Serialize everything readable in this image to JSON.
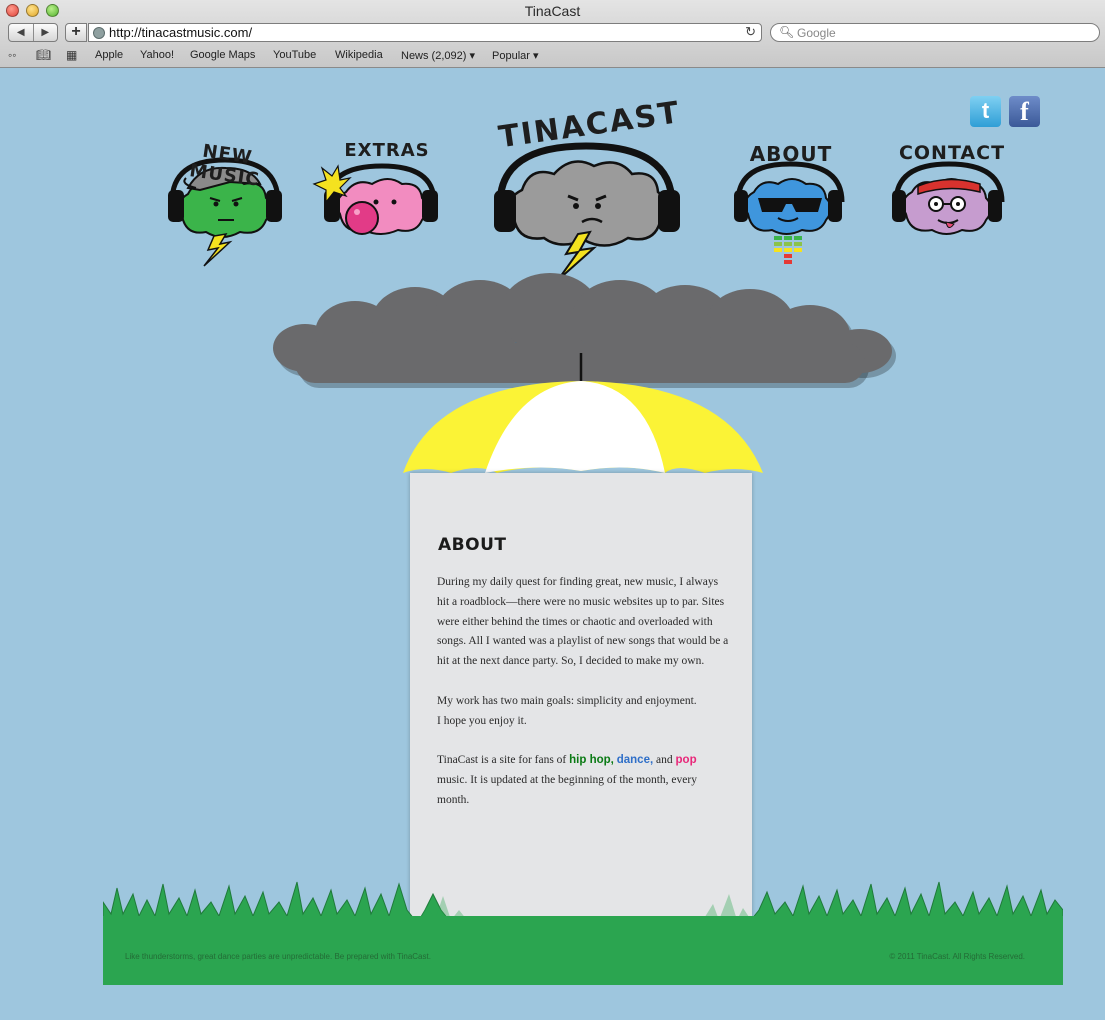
{
  "browser": {
    "window_title": "TinaCast",
    "url": "http://tinacastmusic.com/",
    "search_placeholder": "Google",
    "bookmarks": [
      "Apple",
      "Yahoo!",
      "Google Maps",
      "YouTube",
      "Wikipedia",
      "News (2,092) ▾",
      "Popular ▾"
    ]
  },
  "nav": {
    "items": [
      {
        "label": "NEW MUSIC",
        "color": "#3bb44a"
      },
      {
        "label": "EXTRAS",
        "color": "#f28cc0"
      },
      {
        "label": "ABOUT",
        "color": "#3f96dd"
      },
      {
        "label": "CONTACT",
        "color": "#c69ccf"
      }
    ],
    "logo_text": "TINACAST",
    "logo_color": "#9b9b9b"
  },
  "social": {
    "twitter": "t",
    "facebook": "f"
  },
  "about": {
    "heading": "ABOUT",
    "paragraph1": "During my daily quest for finding great, new music, I always hit a roadblock—there were no music websites up to par. Sites were either behind the times or chaotic and overloaded with songs.  All I wanted was a playlist of new songs that would be a hit at the next dance party.  So, I decided to make my own.",
    "paragraph2_line1": "My work has two main goals: simplicity and enjoyment.",
    "paragraph2_line2": "I hope you enjoy it.",
    "paragraph3_prefix": "TinaCast is a site for fans of ",
    "genre_hiphop": "hip hop,",
    "genre_dance": "dance,",
    "paragraph3_and": " and ",
    "genre_pop": "pop",
    "paragraph3_suffix": " music. It is updated at the beginning of the month, every month."
  },
  "footer": {
    "tagline": "Like thunderstorms, great dance parties are unpredictable. Be prepared with TinaCast.",
    "copyright": "© 2011 TinaCast.  All Rights Reserved."
  },
  "colors": {
    "sky": "#9ec6de",
    "cloud": "#6a6a6c",
    "umbrella_yellow": "#fbf336",
    "grass": "#2ba550"
  }
}
